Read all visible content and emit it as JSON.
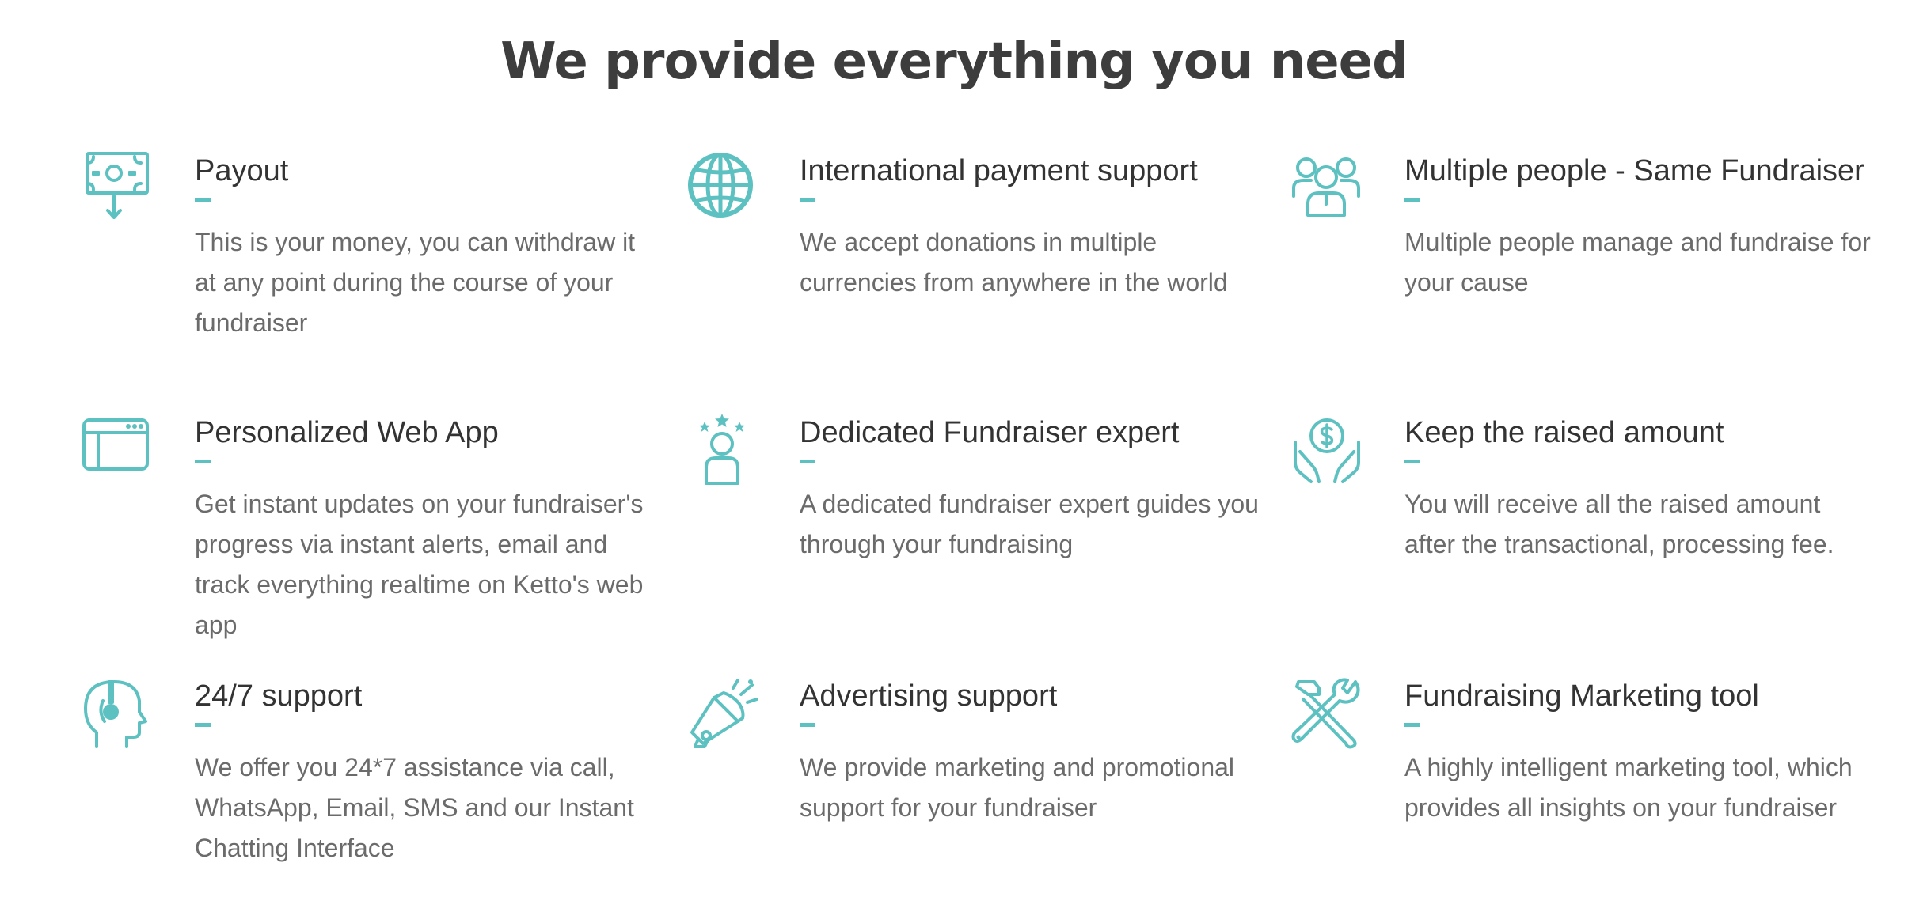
{
  "page": {
    "title": "We provide everything you need"
  },
  "colors": {
    "accent": "#5cc1c0",
    "title_text": "#3d3d3d",
    "desc_text": "#6b6b6b"
  },
  "features": [
    {
      "icon": "money-withdraw-icon",
      "title": "Payout",
      "description": "This is your money, you can withdraw it at any point during the course of your fundraiser"
    },
    {
      "icon": "globe-icon",
      "title": "International payment support",
      "description": "We accept donations in multiple currencies from anywhere in the world"
    },
    {
      "icon": "people-group-icon",
      "title": "Multiple people - Same Fundraiser",
      "description": "Multiple people manage and fundraise for your cause"
    },
    {
      "icon": "browser-window-icon",
      "title": "Personalized Web App",
      "description": "Get instant updates on your fundraiser's progress via instant alerts, email and track everything realtime on Ketto's web app"
    },
    {
      "icon": "expert-person-stars-icon",
      "title": "Dedicated Fundraiser expert",
      "description": "A dedicated fundraiser expert guides you through your fundraising"
    },
    {
      "icon": "hands-dollar-icon",
      "title": "Keep the raised amount",
      "description": "You will receive all the raised amount after the transactional, processing fee."
    },
    {
      "icon": "headset-support-icon",
      "title": "24/7 support",
      "description": "We offer you 24*7 assistance via call, WhatsApp, Email, SMS and our Instant Chatting Interface"
    },
    {
      "icon": "megaphone-icon",
      "title": "Advertising support",
      "description": "We provide marketing and promotional support for your fundraiser"
    },
    {
      "icon": "tools-icon",
      "title": "Fundraising Marketing tool",
      "description": "A highly intelligent marketing tool, which provides all insights on your fundraiser"
    }
  ]
}
